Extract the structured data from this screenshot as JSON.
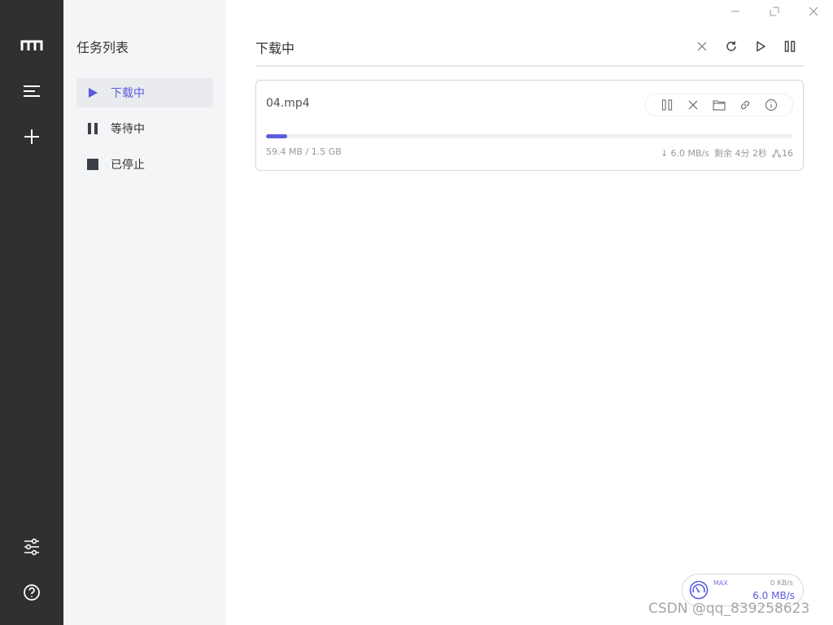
{
  "rail": {
    "items": [
      {
        "name": "logo-icon"
      },
      {
        "name": "menu-icon"
      },
      {
        "name": "add-icon"
      },
      {
        "name": "settings-sliders-icon"
      },
      {
        "name": "help-icon"
      }
    ]
  },
  "sidebar": {
    "title": "任务列表",
    "items": [
      {
        "label": "下载中",
        "icon": "play-icon",
        "active": true
      },
      {
        "label": "等待中",
        "icon": "pause-icon",
        "active": false
      },
      {
        "label": "已停止",
        "icon": "stop-icon",
        "active": false
      }
    ]
  },
  "header": {
    "title": "下载中",
    "toolbar": [
      "close-icon",
      "refresh-icon",
      "play-icon",
      "pause-icon"
    ]
  },
  "task": {
    "name": "04.mp4",
    "size": "59.4 MB / 1.5 GB",
    "progress_fraction": 0.04,
    "speed": "↓ 6.0 MB/s",
    "remaining": "剩余 4分 2秒",
    "connections": "16",
    "actions": [
      "pause-icon",
      "delete-icon",
      "folder-icon",
      "link-icon",
      "info-icon"
    ]
  },
  "speedometer": {
    "max_label": "MAX",
    "upload": "0 KB/s",
    "download": "6.0 MB/s"
  },
  "watermark": "CSDN @qq_839258623",
  "colors": {
    "accent": "#5b5bdf",
    "rail": "#303030",
    "sidebar": "#f4f5f7"
  }
}
